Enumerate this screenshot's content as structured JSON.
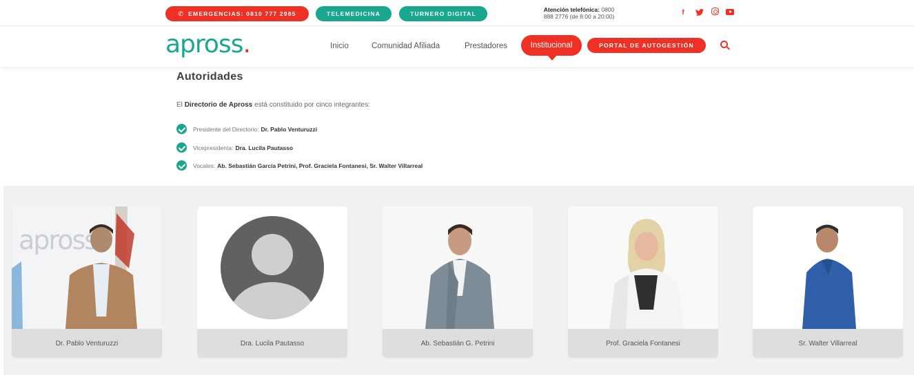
{
  "topbar": {
    "emergency_label": "EMERGENCIAS: 0810 777 2985",
    "telemedicina_label": "TELEMEDICINA",
    "turnero_label": "TURNERO DIGITAL",
    "phone_label": "Atención telefónica:",
    "phone_number": "0800",
    "phone_line2": "888 2776 (de 8:00 a 20:00)",
    "social": [
      "facebook-icon",
      "twitter-icon",
      "instagram-icon",
      "youtube-icon"
    ]
  },
  "navbar": {
    "logo_text": "apross",
    "logo_dot": ".",
    "items": [
      "Inicio",
      "Comunidad Afiliada",
      "Prestadores"
    ],
    "active_item": "Institucional",
    "portal_label": "PORTAL DE AUTOGESTIÓN"
  },
  "content": {
    "title": "Autoridades",
    "intro_prefix": "El",
    "intro_bold": "Directorio de Apross",
    "intro_suffix": "está constituido por cinco integrantes:",
    "list": [
      {
        "label": "Presidente del Directorio:",
        "value": "Dr. Pablo Venturuzzi"
      },
      {
        "label": "Vicepresidenta:",
        "value": "Dra. Lucila Pautasso"
      },
      {
        "label": "Vocales:",
        "value": "Ab. Sebastián García Petrini, Prof. Graciela Fontanesi, Sr. Walter Villarreal"
      }
    ]
  },
  "cards": [
    {
      "name": "Dr. Pablo Venturuzzi"
    },
    {
      "name": "Dra. Lucila Pautasso"
    },
    {
      "name": "Ab. Sebastián G. Petrini"
    },
    {
      "name": "Prof. Graciela Fontanesi"
    },
    {
      "name": "Sr. Walter Villarreal"
    }
  ],
  "colors": {
    "brand_red": "#ee3124",
    "brand_teal": "#1aa78f",
    "card_label_bg": "#dedede",
    "band_bg": "#f1f1f1"
  }
}
